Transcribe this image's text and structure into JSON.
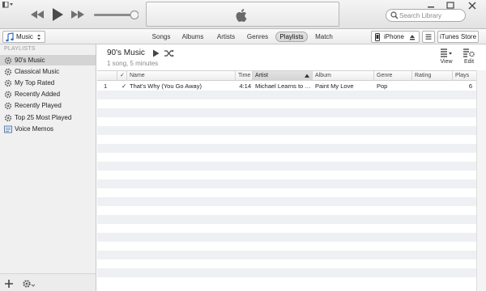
{
  "search": {
    "placeholder": "Search Library"
  },
  "nav": {
    "source": "Music",
    "tabs": [
      {
        "label": "Songs"
      },
      {
        "label": "Albums"
      },
      {
        "label": "Artists"
      },
      {
        "label": "Genres"
      },
      {
        "label": "Playlists",
        "active": true
      },
      {
        "label": "Match"
      }
    ],
    "device": "iPhone",
    "store": "iTunes Store"
  },
  "sidebar": {
    "header": "PLAYLISTS",
    "items": [
      {
        "label": "90's Music",
        "icon": "smart-playlist-gear-icon",
        "selected": true
      },
      {
        "label": "Classical Music",
        "icon": "smart-playlist-gear-icon"
      },
      {
        "label": "My Top Rated",
        "icon": "smart-playlist-gear-icon"
      },
      {
        "label": "Recently Added",
        "icon": "smart-playlist-gear-icon"
      },
      {
        "label": "Recently Played",
        "icon": "smart-playlist-gear-icon"
      },
      {
        "label": "Top 25 Most Played",
        "icon": "smart-playlist-gear-icon"
      },
      {
        "label": "Voice Memos",
        "icon": "playlist-icon"
      }
    ]
  },
  "playlist": {
    "title": "90's Music",
    "subtitle": "1 song, 5 minutes",
    "view_label": "View",
    "edit_label": "Edit"
  },
  "table": {
    "columns": [
      "",
      "✓",
      "Name",
      "Time",
      "Artist",
      "Album",
      "Genre",
      "Rating",
      "Plays"
    ],
    "sorted_column": "Artist",
    "rows": [
      [
        "1",
        "✓",
        "That's Why (You Go Away)",
        "4:14",
        "Michael Learns to Rock",
        "Paint My Love",
        "Pop",
        "",
        "6"
      ]
    ]
  },
  "colors": {
    "selected_row": "#d4d4d4",
    "alt_row": "#eef0f4",
    "sidebar_bg": "#f0f0f0"
  }
}
